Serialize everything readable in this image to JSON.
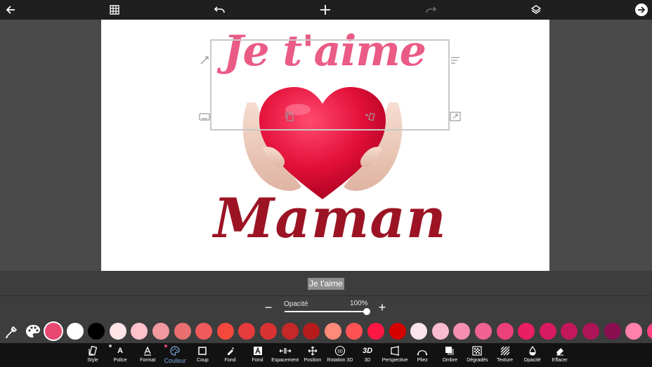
{
  "toolbar_top": {
    "icons": [
      "back-arrow-icon",
      "grid-icon",
      "undo-icon",
      "add-icon",
      "redo-icon",
      "layers-icon",
      "next-arrow-icon"
    ]
  },
  "canvas": {
    "text_top": "Je t'aime",
    "text_bottom": "Maman"
  },
  "text_preview": "Je t'aime",
  "opacity": {
    "label": "Opacité",
    "value_label": "100%",
    "value": 1.0
  },
  "colors": {
    "selected": "#e8476f",
    "swatches": [
      "#e8476f",
      "#ffffff",
      "#000000",
      "#ffe4e8",
      "#ffc1cc",
      "#f09aa0",
      "#ea7070",
      "#f05a5a",
      "#f5483c",
      "#e63c3c",
      "#d93232",
      "#c62828",
      "#b71c1c",
      "#ff8a7a",
      "#ff5252",
      "#ff1744",
      "#d50000",
      "#fce4ec",
      "#f8bbd0",
      "#f48fb1",
      "#f06292",
      "#ec407a",
      "#e91e63",
      "#d81b60",
      "#c2185b",
      "#ad1457",
      "#880e4f",
      "#ff80ab",
      "#ff4081"
    ]
  },
  "tools": [
    {
      "label": "Style",
      "icon": "style-icon"
    },
    {
      "label": "Police",
      "icon": "font-icon"
    },
    {
      "label": "Format",
      "icon": "format-icon"
    },
    {
      "label": "Couleur",
      "icon": "palette-icon"
    },
    {
      "label": "Coup",
      "icon": "stroke-icon"
    },
    {
      "label": "Fond",
      "icon": "fill-icon"
    },
    {
      "label": "Fond",
      "icon": "background-icon"
    },
    {
      "label": "Espacement",
      "icon": "spacing-icon"
    },
    {
      "label": "Position",
      "icon": "position-icon"
    },
    {
      "label": "Rotation 3D",
      "icon": "rotation-3d-icon"
    },
    {
      "label": "3D",
      "icon": "3d-icon"
    },
    {
      "label": "Perspective",
      "icon": "perspective-icon"
    },
    {
      "label": "Pliez",
      "icon": "bend-icon"
    },
    {
      "label": "Ombre",
      "icon": "shadow-icon"
    },
    {
      "label": "Dégradés",
      "icon": "gradient-icon"
    },
    {
      "label": "Texture",
      "icon": "texture-icon"
    },
    {
      "label": "Opacité",
      "icon": "opacity-icon"
    },
    {
      "label": "Effacer",
      "icon": "eraser-icon"
    }
  ],
  "accent": "#e8476f",
  "active_tool_color": "#7ea7d8"
}
